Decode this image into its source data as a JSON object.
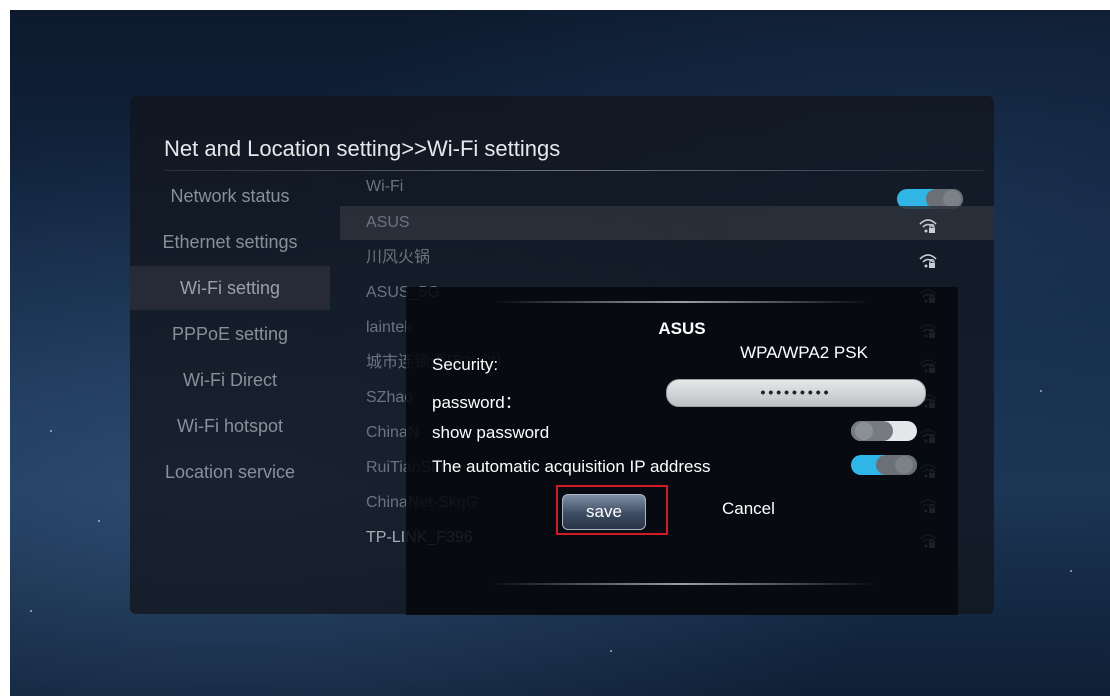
{
  "panel": {
    "title": "Net and Location setting>>Wi-Fi settings"
  },
  "menu": {
    "items": [
      {
        "label": "Network status"
      },
      {
        "label": "Ethernet settings"
      },
      {
        "label": "Wi-Fi setting"
      },
      {
        "label": "PPPoE setting"
      },
      {
        "label": "Wi-Fi Direct"
      },
      {
        "label": "Wi-Fi hotspot"
      },
      {
        "label": "Location service"
      }
    ],
    "active_index": 2
  },
  "wifi": {
    "label": "Wi-Fi",
    "enabled": true,
    "networks": [
      {
        "name": "ASUS"
      },
      {
        "name": "川风火锅"
      },
      {
        "name": "ASUS_5G"
      },
      {
        "name": "laintek"
      },
      {
        "name": "城市连锁酒店3（2）"
      },
      {
        "name": "SZhao"
      },
      {
        "name": "ChinaN"
      },
      {
        "name": "RuiTianShi"
      },
      {
        "name": "ChinaNet-SkqG"
      },
      {
        "name": "TP-LINK_F396"
      }
    ]
  },
  "dialog": {
    "title": "ASUS",
    "security_label": "Security:",
    "security_value": "WPA/WPA2 PSK",
    "password_label": "password：",
    "password_value": "•••••••••",
    "show_password_label": "show password",
    "show_password_enabled": false,
    "auto_ip_label": "The automatic acquisition IP address",
    "auto_ip_enabled": true,
    "save_label": "save",
    "cancel_label": "Cancel"
  },
  "colors": {
    "toggle_on": "#2fb6e6",
    "highlight": "#d01c22"
  },
  "icons": {
    "wifi_signal": "wifi-lock-icon"
  }
}
